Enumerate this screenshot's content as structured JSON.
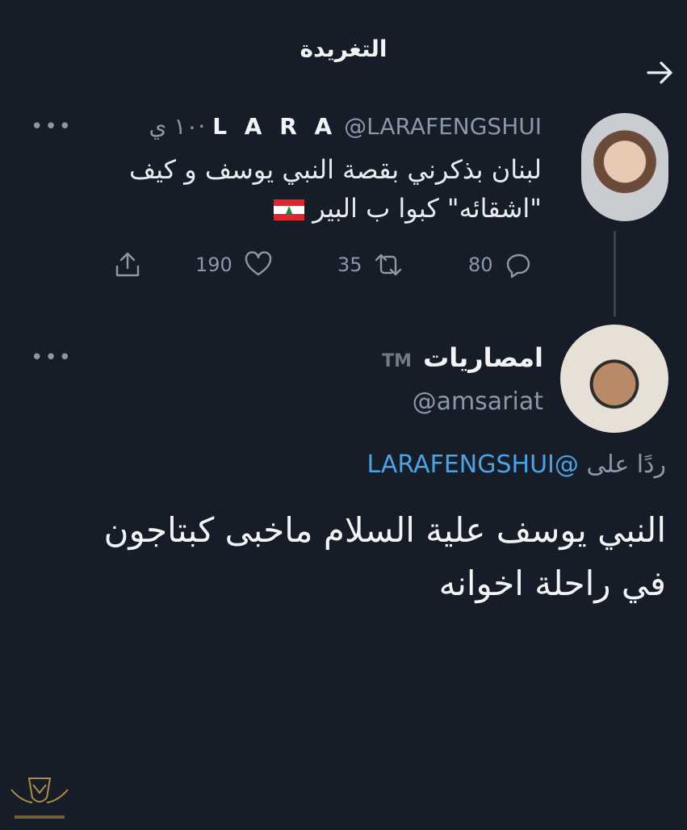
{
  "header": {
    "title": "التغريدة",
    "back_icon": "arrow-right-icon"
  },
  "tweet1": {
    "display_name": "L A R A",
    "handle_time": "@LARAFENGSHUI ·١٠ ي",
    "text_line1": "لبنان بذكرني بقصة النبي يوسف و كيف",
    "text_line2": "\"اشقائه\"  كبوا ب البير",
    "replies": "80",
    "retweets": "35",
    "likes": "190"
  },
  "tweet2": {
    "display_name": "امصاريات",
    "badge": "TM",
    "handle": "@amsariat",
    "reply_prefix": "ردًا على",
    "reply_mention": "@LARAFENGSHUI",
    "text_line1": "النبي يوسف علية السلام ماخبى كبتاجون",
    "text_line2": "في راحلة اخوانه"
  },
  "colors": {
    "background": "#161d28",
    "accent": "#4aa3e4",
    "muted": "#8b98a5"
  }
}
